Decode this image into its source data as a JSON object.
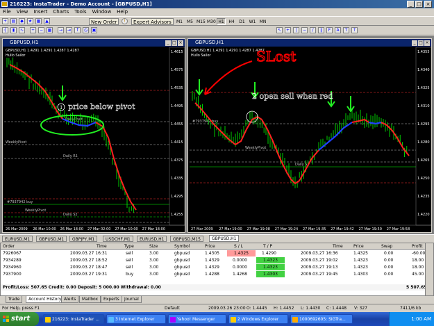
{
  "window": {
    "title": "216223: InstaTrader - Demo Account - [GBPUSD,H1]"
  },
  "menu": [
    "File",
    "View",
    "Insert",
    "Charts",
    "Tools",
    "Window",
    "Help"
  ],
  "toolbar": {
    "new_order": "New Order",
    "expert_advisors": "Expert Advisors",
    "timeframes": [
      "M1",
      "M5",
      "M15",
      "M30",
      "H1",
      "H4",
      "D1",
      "W1",
      "MN"
    ],
    "active_timeframe": "H1"
  },
  "chart_left": {
    "title": "GBPUSD,H1",
    "info": "GBPUSD,H1  1.4291 1.4291 1.4287 1.4287",
    "indicator": "Hullo Sailor",
    "labels": {
      "daily_pivot": "DailyPivot",
      "daily_r1": "Daily R1",
      "weekly_pivot_left": "WeeklyPivot",
      "buy_order": "#7937942 buy",
      "weekly_pivot": "WeeklyPivot",
      "daily_s2": "Daily S2"
    },
    "price_labels": [
      "1.4615",
      "1.4575",
      "1.4535",
      "1.4495",
      "1.4455",
      "1.4415",
      "1.4375",
      "1.4335",
      "1.4295",
      "1.4255"
    ],
    "time_labels": [
      "26 Mar 2009",
      "26 Mar 10:00",
      "26 Mar 18:00",
      "27 Mar 02:00",
      "27 Mar 10:00",
      "27 Mar 18:00"
    ],
    "annotation": "1 price below pivot"
  },
  "chart_right": {
    "title": "GBPUSD,H1",
    "info": "GBPUSD,H1  1.4291 1.4291 1.4287 1.4287",
    "indicator": "Hullo Sailor",
    "labels": {
      "buy_order": "#7937942 buy",
      "weekly_pivot": "WeeklyPivot",
      "daily_s2": "Daily S2"
    },
    "price_labels": [
      "1.4355",
      "1.4340",
      "1.4325",
      "1.4310",
      "1.4295",
      "1.4280",
      "1.4265",
      "1.4250",
      "1.4235",
      "1.4220"
    ],
    "time_labels": [
      "27 Mar 2009",
      "27 Mar 19:00",
      "27 Mar 19:08",
      "27 Mar 19:24",
      "27 Mar 19:35",
      "27 Mar 19:42",
      "27 Mar 19:50",
      "27 Mar 19:58"
    ],
    "annotation_sl": "SLost",
    "annotation_open": "2 open sell when red"
  },
  "chart_tabs": [
    "EURUSD,M1",
    "GBPUSD,M1",
    "GBPJPY,M1",
    "USDCHF,M1",
    "EURUSD,H1",
    "GBPUSD,M15",
    "GBPUSD,H1"
  ],
  "active_chart_tab": "GBPUSD,H1",
  "terminal": {
    "columns": [
      "Order",
      "Time",
      "Type",
      "Size",
      "Symbol",
      "Price",
      "S / L",
      "T / P",
      "Time",
      "Price",
      "Swap",
      "Profit"
    ],
    "rows": [
      {
        "order": "7926067",
        "time": "2009.03.27 16:31",
        "type": "sell",
        "size": "3.00",
        "symbol": "gbpusd",
        "price": "1.4305",
        "sl": "1.4325",
        "tp": "1.4290",
        "ctime": "2009.03.27 16:36",
        "cprice": "1.4325",
        "swap": "0.00",
        "profit": "-60.00"
      },
      {
        "order": "7934289",
        "time": "2009.03.27 18:52",
        "type": "sell",
        "size": "3.00",
        "symbol": "gbpusd",
        "price": "1.4329",
        "sl": "0.0000",
        "tp": "1.4323",
        "ctime": "2009.03.27 19:02",
        "cprice": "1.4323",
        "swap": "0.00",
        "profit": "18.00"
      },
      {
        "order": "7934960",
        "time": "2009.03.27 18:47",
        "type": "sell",
        "size": "3.00",
        "symbol": "gbpusd",
        "price": "1.4329",
        "sl": "0.0000",
        "tp": "1.4323",
        "ctime": "2009.03.27 19:13",
        "cprice": "1.4323",
        "swap": "0.00",
        "profit": "18.00"
      },
      {
        "order": "7937900",
        "time": "2009.03.27 19:31",
        "type": "buy",
        "size": "3.00",
        "symbol": "gbpusd",
        "price": "1.4288",
        "sl": "1.4268",
        "tp": "1.4303",
        "ctime": "2009.03.27 19:45",
        "cprice": "1.4303",
        "swap": "0.00",
        "profit": "45.00"
      }
    ],
    "summary": "Profit/Loss: 507.65  Credit: 0.00  Deposit: 5 000.00  Withdrawal: 0.00",
    "summary_total": "5 507.65",
    "tabs": [
      "Trade",
      "Account History",
      "Alerts",
      "Mailbox",
      "Experts",
      "Journal"
    ],
    "active_tab": "Account History",
    "side_label": "Terminal"
  },
  "statusbar": {
    "help": "For Help, press F1",
    "profile": "Default",
    "datetime": "2009.03.26 23:00",
    "open": "O: 1.4445",
    "high": "H: 1.4452",
    "low": "L: 1.4430",
    "close": "C: 1.4448",
    "volume": "V: 327",
    "traffic": "7411/6 kb"
  },
  "taskbar": {
    "start": "start",
    "items": [
      "216223: InstaTrader ...",
      "3 Internet Explorer",
      "Yahoo! Messenger",
      "2 Windows Explorer",
      "1000692605: SIGTra..."
    ],
    "clock": "1:00 AM"
  },
  "colors": {
    "bull": "#00ff00",
    "trend_red": "#ff2020",
    "trend_blue": "#2040ff",
    "loss_cell": "#ff9a9a",
    "profit_cell": "#42d142"
  }
}
